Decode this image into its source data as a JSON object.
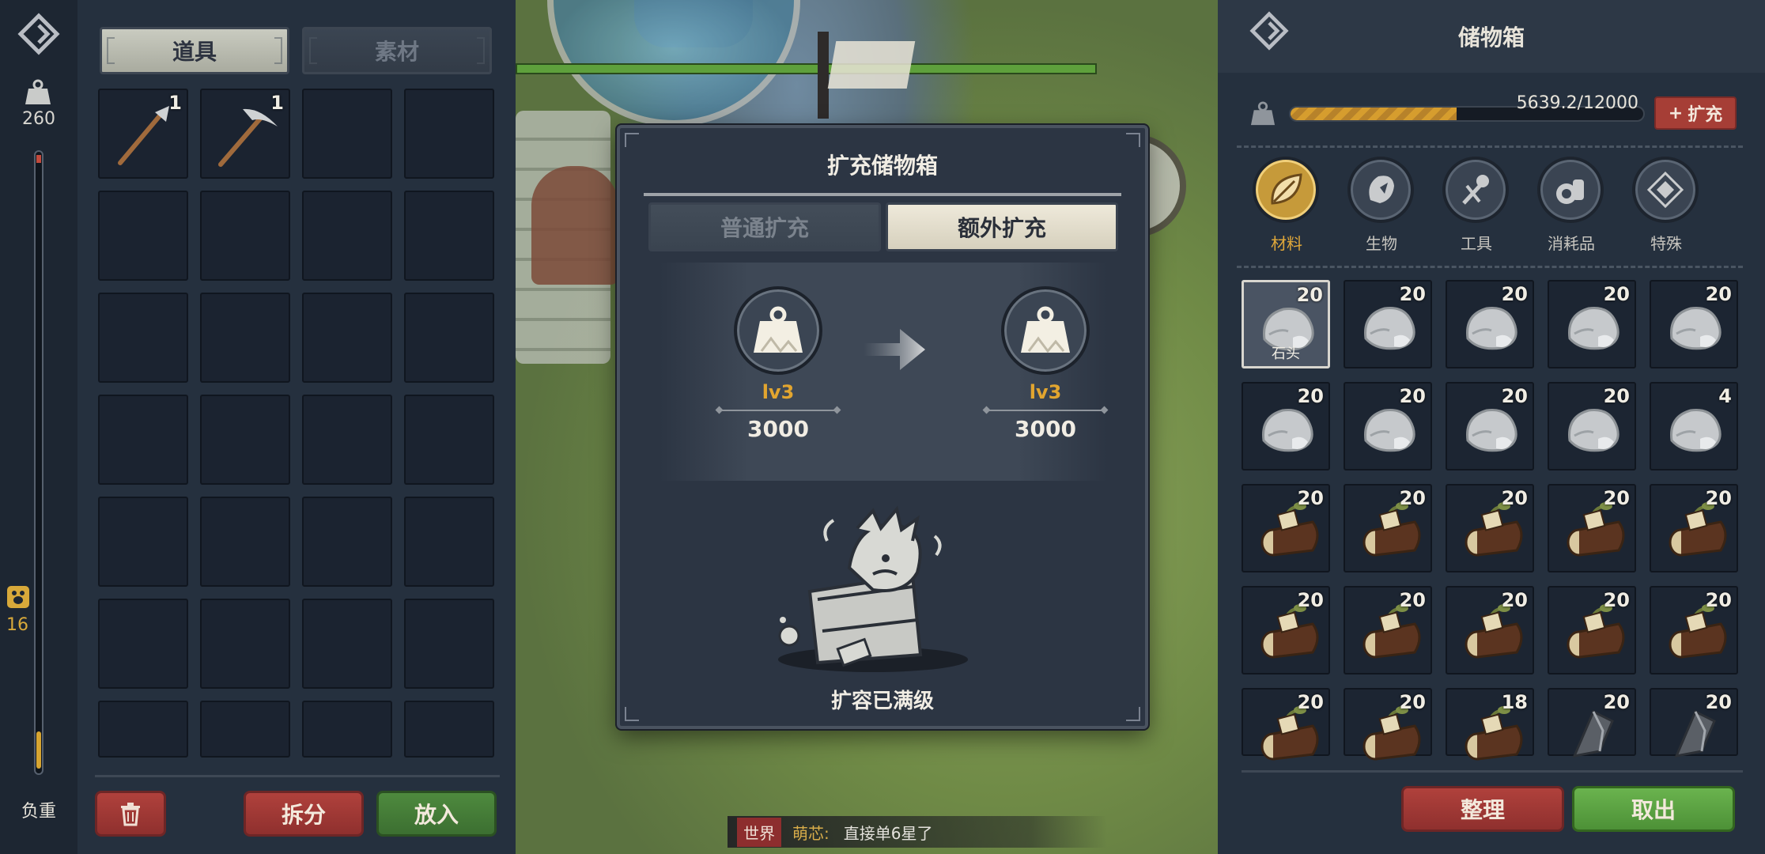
{
  "left_strip": {
    "weight_value": "260",
    "paw_value": "16",
    "load_label": "负重",
    "load_fraction": 0.06
  },
  "inventory": {
    "tabs": [
      {
        "label": "道具",
        "active": true
      },
      {
        "label": "素材",
        "active": false
      }
    ],
    "items": [
      {
        "icon": "axe-icon",
        "count": "1"
      },
      {
        "icon": "pickaxe-icon",
        "count": "1"
      }
    ],
    "buttons": {
      "split": "拆分",
      "put_in": "放入"
    }
  },
  "storage": {
    "title": "储物箱",
    "capacity_text": "5639.2/12000",
    "capacity_fraction": 0.47,
    "expand_label": "扩充",
    "categories": [
      {
        "label": "材料",
        "icon": "leaf-icon",
        "active": true
      },
      {
        "label": "生物",
        "icon": "creature-icon",
        "active": false
      },
      {
        "label": "工具",
        "icon": "tool-icon",
        "active": false
      },
      {
        "label": "消耗品",
        "icon": "consumable-icon",
        "active": false
      },
      {
        "label": "特殊",
        "icon": "special-icon",
        "active": false
      }
    ],
    "items": [
      {
        "icon": "stone-icon",
        "count": "20",
        "name": "石头"
      },
      {
        "icon": "stone-icon",
        "count": "20"
      },
      {
        "icon": "stone-icon",
        "count": "20"
      },
      {
        "icon": "stone-icon",
        "count": "20"
      },
      {
        "icon": "stone-icon",
        "count": "20"
      },
      {
        "icon": "stone-icon",
        "count": "20"
      },
      {
        "icon": "stone-icon",
        "count": "20"
      },
      {
        "icon": "stone-icon",
        "count": "20"
      },
      {
        "icon": "stone-icon",
        "count": "20"
      },
      {
        "icon": "stone-icon",
        "count": "4"
      },
      {
        "icon": "log-icon",
        "count": "20"
      },
      {
        "icon": "log-icon",
        "count": "20"
      },
      {
        "icon": "log-icon",
        "count": "20"
      },
      {
        "icon": "log-icon",
        "count": "20"
      },
      {
        "icon": "log-icon",
        "count": "20"
      },
      {
        "icon": "log-icon",
        "count": "20"
      },
      {
        "icon": "log-icon",
        "count": "20"
      },
      {
        "icon": "log-icon",
        "count": "20"
      },
      {
        "icon": "log-icon",
        "count": "20"
      },
      {
        "icon": "log-icon",
        "count": "20"
      },
      {
        "icon": "log-icon",
        "count": "20"
      },
      {
        "icon": "log-icon",
        "count": "20"
      },
      {
        "icon": "log-icon",
        "count": "18"
      },
      {
        "icon": "flint-icon",
        "count": "20"
      },
      {
        "icon": "flint-icon",
        "count": "20"
      }
    ],
    "buttons": {
      "sort": "整理",
      "take_out": "取出"
    }
  },
  "modal": {
    "title": "扩充储物箱",
    "tabs": [
      {
        "label": "普通扩充",
        "active": false
      },
      {
        "label": "额外扩充",
        "active": true
      }
    ],
    "current": {
      "level": "lv3",
      "capacity": "3000"
    },
    "next": {
      "level": "lv3",
      "capacity": "3000"
    },
    "status_text": "扩容已满级"
  },
  "chat": {
    "channel": "世界",
    "sender": "萌芯:",
    "message": "直接单6星了"
  },
  "colors": {
    "accent_gold": "#e2a52f",
    "button_red": "#a63e36",
    "button_green": "#4e8a3e",
    "panel_bg": "#25303e"
  }
}
